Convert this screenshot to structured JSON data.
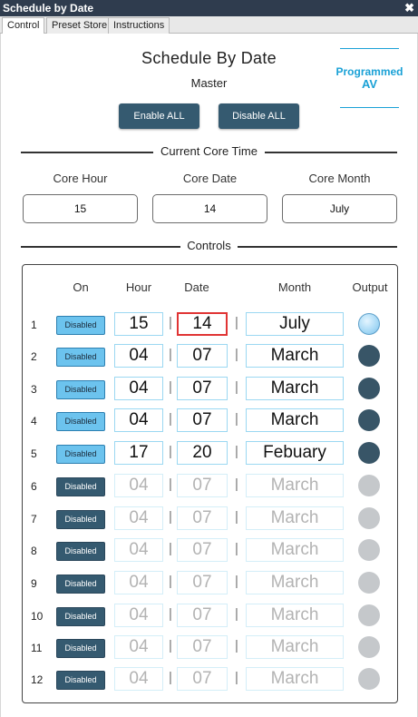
{
  "window": {
    "title": "Schedule by Date",
    "close_glyph": "✖"
  },
  "tabs": [
    {
      "label": "Control",
      "active": true
    },
    {
      "label": "Preset Store",
      "active": false
    },
    {
      "label": "Instructions",
      "active": false
    }
  ],
  "header": {
    "title": "Schedule By Date",
    "subtitle": "Master",
    "logo_line1": "Programmed",
    "logo_line2": "AV",
    "enable_all_label": "Enable ALL",
    "disable_all_label": "Disable ALL"
  },
  "core_time": {
    "section_title": "Current Core Time",
    "hour_label": "Core Hour",
    "date_label": "Core Date",
    "month_label": "Core Month",
    "hour_value": "15",
    "date_value": "14",
    "month_value": "July"
  },
  "controls": {
    "section_title": "Controls",
    "columns": {
      "on": "On",
      "hour": "Hour",
      "date": "Date",
      "month": "Month",
      "output": "Output"
    },
    "separator": "|",
    "rows": [
      {
        "num": "1",
        "toggle": "Disabled",
        "hour": "15",
        "date": "14",
        "month": "July",
        "toggle_state": "light",
        "active": true,
        "output": "lit",
        "date_selected": true
      },
      {
        "num": "2",
        "toggle": "Disabled",
        "hour": "04",
        "date": "07",
        "month": "March",
        "toggle_state": "light",
        "active": true,
        "output": "dark"
      },
      {
        "num": "3",
        "toggle": "Disabled",
        "hour": "04",
        "date": "07",
        "month": "March",
        "toggle_state": "light",
        "active": true,
        "output": "dark"
      },
      {
        "num": "4",
        "toggle": "Disabled",
        "hour": "04",
        "date": "07",
        "month": "March",
        "toggle_state": "light",
        "active": true,
        "output": "dark"
      },
      {
        "num": "5",
        "toggle": "Disabled",
        "hour": "17",
        "date": "20",
        "month": "Febuary",
        "toggle_state": "light",
        "active": true,
        "output": "dark"
      },
      {
        "num": "6",
        "toggle": "Disabled",
        "hour": "04",
        "date": "07",
        "month": "March",
        "toggle_state": "dark",
        "active": false,
        "output": "off"
      },
      {
        "num": "7",
        "toggle": "Disabled",
        "hour": "04",
        "date": "07",
        "month": "March",
        "toggle_state": "dark",
        "active": false,
        "output": "off"
      },
      {
        "num": "8",
        "toggle": "Disabled",
        "hour": "04",
        "date": "07",
        "month": "March",
        "toggle_state": "dark",
        "active": false,
        "output": "off"
      },
      {
        "num": "9",
        "toggle": "Disabled",
        "hour": "04",
        "date": "07",
        "month": "March",
        "toggle_state": "dark",
        "active": false,
        "output": "off"
      },
      {
        "num": "10",
        "toggle": "Disabled",
        "hour": "04",
        "date": "07",
        "month": "March",
        "toggle_state": "dark",
        "active": false,
        "output": "off"
      },
      {
        "num": "11",
        "toggle": "Disabled",
        "hour": "04",
        "date": "07",
        "month": "March",
        "toggle_state": "dark",
        "active": false,
        "output": "off"
      },
      {
        "num": "12",
        "toggle": "Disabled",
        "hour": "04",
        "date": "07",
        "month": "March",
        "toggle_state": "dark",
        "active": false,
        "output": "off"
      }
    ]
  },
  "colors": {
    "titlebar": "#2f3c4e",
    "button_dark": "#355a70",
    "toggle_light": "#6cc3ee",
    "selection_border": "#e03434",
    "logo_accent": "#1aa1d6"
  }
}
